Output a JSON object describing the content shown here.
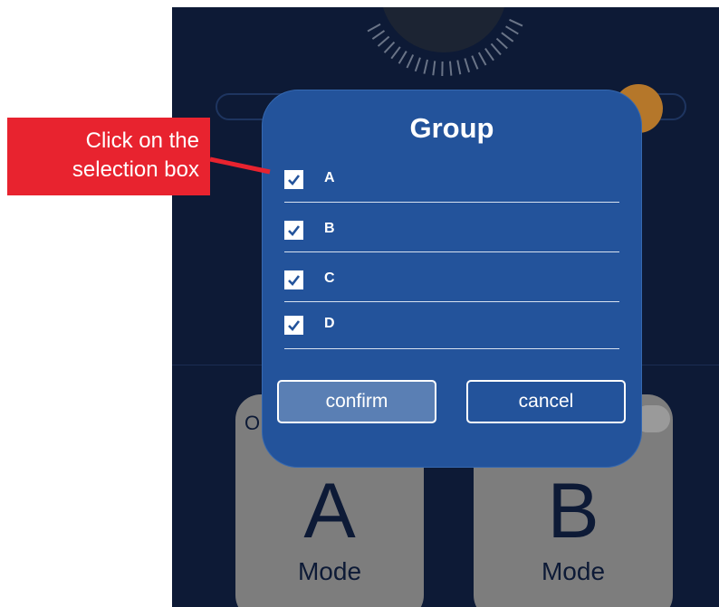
{
  "dialog": {
    "title": "Group",
    "options": [
      {
        "label": "A",
        "checked": true
      },
      {
        "label": "B",
        "checked": true
      },
      {
        "label": "C",
        "checked": true
      },
      {
        "label": "D",
        "checked": true
      }
    ],
    "confirm_label": "confirm",
    "cancel_label": "cancel"
  },
  "background_cards": [
    {
      "letter": "A",
      "label": "Mode",
      "fragment": "O"
    },
    {
      "letter": "B",
      "label": "Mode"
    }
  ],
  "annotation": {
    "text_line1": "Click on the",
    "text_line2": "selection box"
  },
  "colors": {
    "app_background": "#0d1a36",
    "dialog_background": "#23539b",
    "confirm_button": "#5a7fb4",
    "annotation": "#e8232f",
    "slider_knob": "#b5772a",
    "card": "#7d7d7d"
  },
  "icons": [
    "checkbox-checked-icon",
    "dial-icon"
  ]
}
